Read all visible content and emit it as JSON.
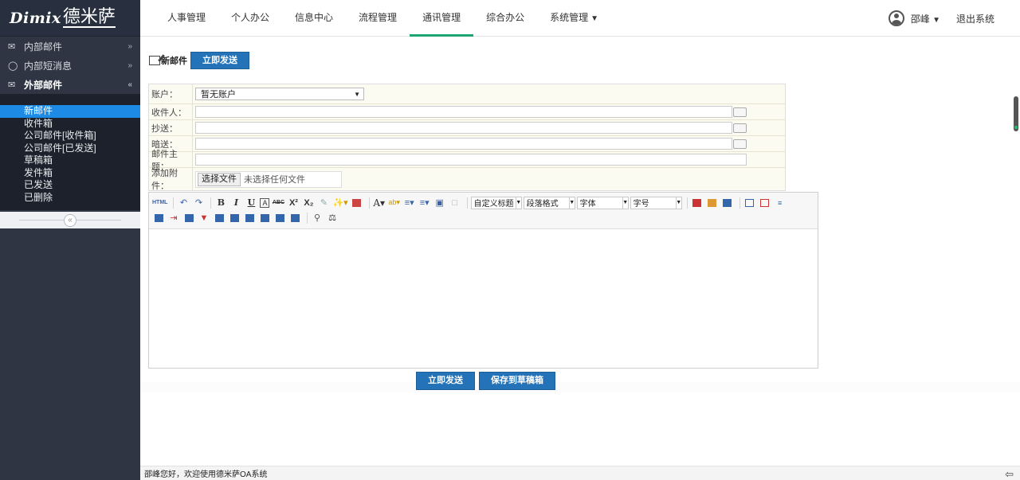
{
  "logo": {
    "latin": "Dimix",
    "chinese": "德米萨"
  },
  "sidebar": {
    "groups": [
      {
        "label": "内部邮件",
        "icon": "envelope-outline-icon",
        "arrow": "»"
      },
      {
        "label": "内部短消息",
        "icon": "chat-bubble-icon",
        "arrow": "»"
      },
      {
        "label": "外部邮件",
        "icon": "envelope-filled-icon",
        "arrow": "«"
      }
    ],
    "items": [
      {
        "label": "新邮件"
      },
      {
        "label": "收件箱"
      },
      {
        "label": "公司邮件[收件箱]"
      },
      {
        "label": "公司邮件[已发送]"
      },
      {
        "label": "草稿箱"
      },
      {
        "label": "发件箱"
      },
      {
        "label": "已发送"
      },
      {
        "label": "已删除"
      }
    ],
    "collapse_symbol": "«"
  },
  "nav": {
    "tabs": [
      {
        "label": "人事管理"
      },
      {
        "label": "个人办公"
      },
      {
        "label": "信息中心"
      },
      {
        "label": "流程管理"
      },
      {
        "label": "通讯管理"
      },
      {
        "label": "综合办公"
      },
      {
        "label": "系统管理"
      }
    ],
    "active": "通讯管理"
  },
  "user": {
    "name": "邵峰",
    "logout": "退出系统"
  },
  "page": {
    "title": "新邮件",
    "send_now": "立即发送"
  },
  "form": {
    "account_label": "账户：",
    "account_value": "暂无账户",
    "to_label": "收件人：",
    "cc_label": "抄送：",
    "bcc_label": "暗送：",
    "subject_label": "邮件主题：",
    "attach_label": "添加附件：",
    "file_button": "选择文件",
    "file_status": "未选择任何文件"
  },
  "editor": {
    "html_label": "HTML",
    "dropdowns": [
      "自定义标题",
      "段落格式",
      "字体",
      "字号"
    ]
  },
  "actions": {
    "send": "立即发送",
    "save_draft": "保存到草稿箱"
  },
  "status": {
    "text": "邵峰您好，欢迎使用德米萨OA系统"
  }
}
